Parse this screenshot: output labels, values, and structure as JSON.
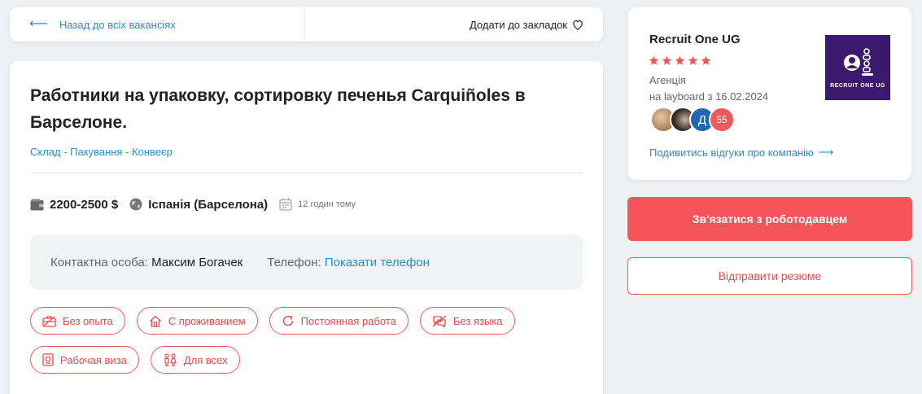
{
  "topbar": {
    "back_label": "Назад до всіх вакансіях",
    "bookmark_label": "Додати до закладок"
  },
  "job": {
    "title": "Работники на упаковку, сортировку печенья Carquiñoles в Барселоне.",
    "categories": "Склад - Пакування - Конвеєр",
    "salary": "2200-2500 $",
    "location": "Іспанія (Барселона)",
    "posted": "12 годин тому"
  },
  "contact": {
    "person_label": "Контактна особа:",
    "person_name": "Максим Богачек",
    "phone_label": "Телефон:",
    "phone_link": "Показати телефон"
  },
  "tags": {
    "row1": [
      {
        "label": "Без опыта",
        "icon": "briefcase-icon"
      },
      {
        "label": "С проживанием",
        "icon": "house-icon"
      },
      {
        "label": "Постоянная работа",
        "icon": "refresh-icon"
      },
      {
        "label": "Без языка",
        "icon": "no-language-icon"
      }
    ],
    "row2": [
      {
        "label": "Рабочая виза",
        "icon": "passport-icon"
      },
      {
        "label": "Для всех",
        "icon": "people-icon"
      }
    ]
  },
  "company": {
    "name": "Recruit One UG",
    "rating_stars": 5,
    "type": "Агенція",
    "since": "на layboard з 16.02.2024",
    "avatar_letter": "Д",
    "reviews_count": "55",
    "reviews_link": "Подивитись відгуки про компанію",
    "logo_text": "RECRUIT ONE UG"
  },
  "actions": {
    "contact_button": "Зв'язатися з роботодавцем",
    "resume_button": "Відправити резюме"
  },
  "colors": {
    "accent_red": "#f5555a",
    "link_blue": "#2a8fcd",
    "logo_purple": "#3b1a6e"
  }
}
